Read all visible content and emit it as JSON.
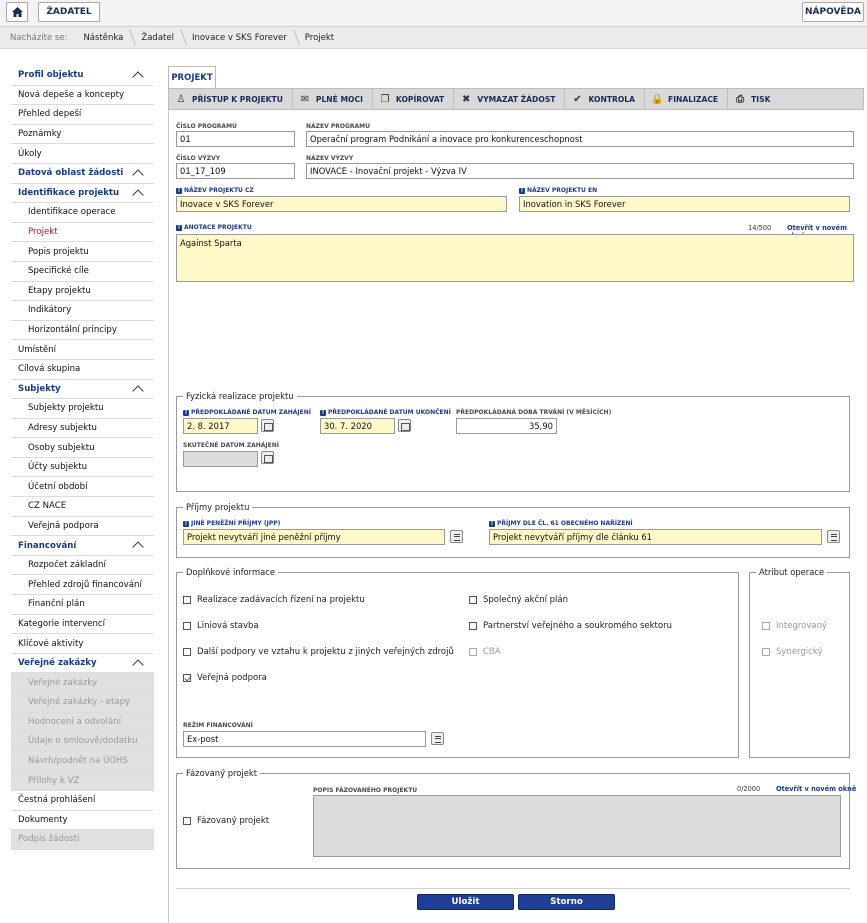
{
  "topbar": {
    "home_icon": "home-icon",
    "applicant_label": "ŽADATEL",
    "help_label": "NÁPOVĚDA"
  },
  "breadcrumb": {
    "label": "Nacházíte se:",
    "items": [
      "Nástěnka",
      "Žadatel",
      "Inovace v SKS Forever",
      "Projekt"
    ]
  },
  "sidebar": {
    "items": [
      {
        "label": "Profil objektu",
        "type": "sec",
        "chev": true
      },
      {
        "label": "Nová depeše a koncepty",
        "type": "item"
      },
      {
        "label": "Přehled depeší",
        "type": "item"
      },
      {
        "label": "Poznámky",
        "type": "item"
      },
      {
        "label": "Úkoly",
        "type": "item"
      },
      {
        "label": "Datová oblast žádosti",
        "type": "sec",
        "chev": true
      },
      {
        "label": "Identifikace projektu",
        "type": "sec",
        "chev": true
      },
      {
        "label": "Identifikace operace",
        "type": "sub"
      },
      {
        "label": "Projekt",
        "type": "sub",
        "active": true
      },
      {
        "label": "Popis projektu",
        "type": "sub"
      },
      {
        "label": "Specifické cíle",
        "type": "sub"
      },
      {
        "label": "Etapy projektu",
        "type": "sub"
      },
      {
        "label": "Indikátory",
        "type": "sub"
      },
      {
        "label": "Horizontální principy",
        "type": "sub"
      },
      {
        "label": "Umístění",
        "type": "item"
      },
      {
        "label": "Cílová skupina",
        "type": "item"
      },
      {
        "label": "Subjekty",
        "type": "sec",
        "chev": true
      },
      {
        "label": "Subjekty projektu",
        "type": "sub"
      },
      {
        "label": "Adresy subjektu",
        "type": "sub"
      },
      {
        "label": "Osoby subjektu",
        "type": "sub"
      },
      {
        "label": "Účty subjektu",
        "type": "sub"
      },
      {
        "label": "Účetní období",
        "type": "sub"
      },
      {
        "label": "CZ NACE",
        "type": "sub"
      },
      {
        "label": "Veřejná podpora",
        "type": "sub"
      },
      {
        "label": "Financování",
        "type": "sec",
        "chev": true
      },
      {
        "label": "Rozpočet základní",
        "type": "sub"
      },
      {
        "label": "Přehled zdrojů financování",
        "type": "sub"
      },
      {
        "label": "Finanční plán",
        "type": "sub"
      },
      {
        "label": "Kategorie intervencí",
        "type": "item"
      },
      {
        "label": "Klíčové aktivity",
        "type": "item"
      },
      {
        "label": "Veřejné zakázky",
        "type": "sec",
        "chev": true
      },
      {
        "label": "Veřejné zakázky",
        "type": "sub",
        "disabled": true
      },
      {
        "label": "Veřejné zakázky - etapy",
        "type": "sub",
        "disabled": true
      },
      {
        "label": "Hodnocení a odvolání",
        "type": "sub",
        "disabled": true
      },
      {
        "label": "Údaje o smlouvě/dodatku",
        "type": "sub",
        "disabled": true
      },
      {
        "label": "Návrh/podnět na ÚOHS",
        "type": "sub",
        "disabled": true
      },
      {
        "label": "Přílohy k VZ",
        "type": "sub",
        "disabled": true
      },
      {
        "label": "Čestná prohlášení",
        "type": "item"
      },
      {
        "label": "Dokumenty",
        "type": "item"
      },
      {
        "label": "Podpis žádosti",
        "type": "item",
        "disabled": true
      }
    ]
  },
  "tab": {
    "label": "PROJEKT"
  },
  "toolbar": {
    "items": [
      {
        "label": "PŘÍSTUP K PROJEKTU",
        "icon": "users-icon"
      },
      {
        "label": "PLNÉ MOCI",
        "icon": "envelope-icon"
      },
      {
        "label": "KOPÍROVAT",
        "icon": "copy-icon"
      },
      {
        "label": "VYMAZAT ŽÁDOST",
        "icon": "delete-icon"
      },
      {
        "label": "KONTROLA",
        "icon": "check-icon"
      },
      {
        "label": "FINALIZACE",
        "icon": "lock-icon"
      },
      {
        "label": "TISK",
        "icon": "print-icon"
      }
    ]
  },
  "form": {
    "program_number_label": "ČÍSLO PROGRAMU",
    "program_number": "01",
    "program_name_label": "NÁZEV PROGRAMU",
    "program_name": "Operační program Podnikání a inovace pro konkurenceschopnost",
    "call_number_label": "ČÍSLO VÝZVY",
    "call_number": "01_17_109",
    "call_name_label": "NÁZEV VÝZVY",
    "call_name": "INOVACE - Inovační projekt - Výzva IV",
    "project_name_cz_label": "NÁZEV PROJEKTU CZ",
    "project_name_cz": "Inovace v SKS Forever",
    "project_name_en_label": "NÁZEV PROJEKTU EN",
    "project_name_en": "Inovation in SKS Forever",
    "annotation_label": "ANOTACE PROJEKTU",
    "annotation_counter": "14/500",
    "open_new_window": "Otevřít v novém okně",
    "annotation": "Against Sparta",
    "physical": {
      "legend": "Fyzická realizace projektu",
      "start_label": "PŘEDPOKLÁDANÉ DATUM ZAHÁJENÍ",
      "start": "2. 8. 2017",
      "end_label": "PŘEDPOKLÁDANÉ DATUM UKONČENÍ",
      "end": "30. 7. 2020",
      "duration_label": "PŘEDPOKLÁDANÁ DOBA TRVÁNÍ (V MĚSÍCÍCH)",
      "duration": "35,90",
      "actual_start_label": "SKUTEČNÉ DATUM ZAHÁJENÍ",
      "actual_start": ""
    },
    "income": {
      "legend": "Příjmy projektu",
      "jpp_label": "JINÉ PENĚŽNÍ PŘÍJMY (JPP)",
      "jpp": "Projekt nevytváří jiné peněžní příjmy",
      "art61_label": "PŘÍJMY DLE ČL. 61 OBECNÉHO NAŘÍZENÍ",
      "art61": "Projekt nevytváří příjmy dle článku 61"
    },
    "additional": {
      "legend": "Doplňkové informace",
      "cb1": "Realizace zadávacích řízení na projektu",
      "cb2": "Liniová stavba",
      "cb3": "Další podpory ve vztahu k projektu z jiných veřejných zdrojů",
      "cb4": "Veřejná podpora",
      "cb5": "Společný akční plán",
      "cb6": "Partnerství veřejného a soukromého sektoru",
      "cb7": "CBA",
      "financing_label": "REŽIM FINANCOVÁNÍ",
      "financing": "Ex-post"
    },
    "attribute": {
      "legend": "Atribut operace",
      "cb1": "Integrovaný",
      "cb2": "Synergický"
    },
    "phased": {
      "legend": "Fázovaný projekt",
      "checkbox": "Fázovaný projekt",
      "desc_label": "POPIS FÁZOVANÉHO PROJEKTU",
      "desc_counter": "0/2000",
      "open_new_window": "Otevřít v novém okně"
    }
  },
  "buttons": {
    "save": "Uložit",
    "cancel": "Storno"
  }
}
